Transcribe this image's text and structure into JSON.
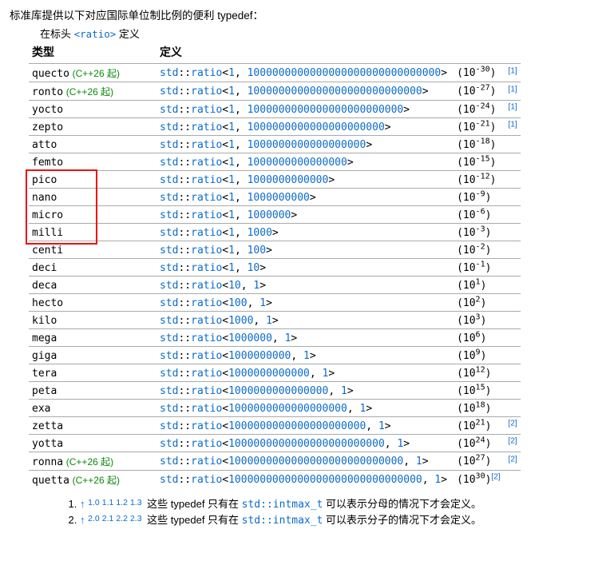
{
  "intro": "标准库提供以下对应国际单位制比例的便利 typedef：",
  "headerNote": {
    "prefix": "在标头 ",
    "code": "<ratio>",
    "suffix": " 定义"
  },
  "columns": {
    "type": "类型",
    "def": "定义"
  },
  "prefix": "std",
  "rationame": "ratio",
  "rows": [
    {
      "name": "quecto",
      "tag": "(C++26 起)",
      "num": "1",
      "den": "1000000000000000000000000000000",
      "exp": "-30",
      "ref": "[1]",
      "refLong": true
    },
    {
      "name": "ronto",
      "tag": "(C++26 起)",
      "num": "1",
      "den": "1000000000000000000000000000",
      "exp": "-27",
      "ref": "[1]",
      "refLong": true
    },
    {
      "name": "yocto",
      "tag": "",
      "num": "1",
      "den": "1000000000000000000000000",
      "exp": "-24",
      "ref": "[1]",
      "refLong": true
    },
    {
      "name": "zepto",
      "tag": "",
      "num": "1",
      "den": "1000000000000000000000",
      "exp": "-21",
      "ref": "[1]",
      "refLong": true
    },
    {
      "name": "atto",
      "tag": "",
      "num": "1",
      "den": "1000000000000000000",
      "exp": "-18",
      "ref": "",
      "refLong": false
    },
    {
      "name": "femto",
      "tag": "",
      "num": "1",
      "den": "1000000000000000",
      "exp": "-15",
      "ref": "",
      "refLong": false
    },
    {
      "name": "pico",
      "tag": "",
      "num": "1",
      "den": "1000000000000",
      "exp": "-12",
      "ref": "",
      "refLong": false
    },
    {
      "name": "nano",
      "tag": "",
      "num": "1",
      "den": "1000000000",
      "exp": "-9",
      "ref": "",
      "refLong": false
    },
    {
      "name": "micro",
      "tag": "",
      "num": "1",
      "den": "1000000",
      "exp": "-6",
      "ref": "",
      "refLong": false
    },
    {
      "name": "milli",
      "tag": "",
      "num": "1",
      "den": "1000",
      "exp": "-3",
      "ref": "",
      "refLong": false
    },
    {
      "name": "centi",
      "tag": "",
      "num": "1",
      "den": "100",
      "exp": "-2",
      "ref": "",
      "refLong": false
    },
    {
      "name": "deci",
      "tag": "",
      "num": "1",
      "den": "10",
      "exp": "-1",
      "ref": "",
      "refLong": false
    },
    {
      "name": "deca",
      "tag": "",
      "num": "10",
      "den": "1",
      "exp": "1",
      "ref": "",
      "refLong": false
    },
    {
      "name": "hecto",
      "tag": "",
      "num": "100",
      "den": "1",
      "exp": "2",
      "ref": "",
      "refLong": false
    },
    {
      "name": "kilo",
      "tag": "",
      "num": "1000",
      "den": "1",
      "exp": "3",
      "ref": "",
      "refLong": false
    },
    {
      "name": "mega",
      "tag": "",
      "num": "1000000",
      "den": "1",
      "exp": "6",
      "ref": "",
      "refLong": false
    },
    {
      "name": "giga",
      "tag": "",
      "num": "1000000000",
      "den": "1",
      "exp": "9",
      "ref": "",
      "refLong": false
    },
    {
      "name": "tera",
      "tag": "",
      "num": "1000000000000",
      "den": "1",
      "exp": "12",
      "ref": "",
      "refLong": false
    },
    {
      "name": "peta",
      "tag": "",
      "num": "1000000000000000",
      "den": "1",
      "exp": "15",
      "ref": "",
      "refLong": false
    },
    {
      "name": "exa",
      "tag": "",
      "num": "1000000000000000000",
      "den": "1",
      "exp": "18",
      "ref": "",
      "refLong": false
    },
    {
      "name": "zetta",
      "tag": "",
      "num": "1000000000000000000000",
      "den": "1",
      "exp": "21",
      "ref": "[2]",
      "refLong": true
    },
    {
      "name": "yotta",
      "tag": "",
      "num": "1000000000000000000000000",
      "den": "1",
      "exp": "24",
      "ref": "[2]",
      "refLong": true
    },
    {
      "name": "ronna",
      "tag": "(C++26 起)",
      "num": "1000000000000000000000000000",
      "den": "1",
      "exp": "27",
      "ref": "[2]",
      "refLong": true
    },
    {
      "name": "quetta",
      "tag": "(C++26 起)",
      "num": "1000000000000000000000000000000",
      "den": "1",
      "exp": "30",
      "ref": "[2]",
      "refLong": false
    }
  ],
  "highlight": {
    "from": "pico",
    "to": "milli"
  },
  "footnotes": [
    {
      "mark": "1.",
      "arrow": "↑",
      "refs": [
        "1.0",
        "1.1",
        "1.2",
        "1.3"
      ],
      "text1": "这些 typedef 只有在 ",
      "code": "std::intmax_t",
      "text2": " 可以表示分母的情况下才会定义。"
    },
    {
      "mark": "2.",
      "arrow": "↑",
      "refs": [
        "2.0",
        "2.1",
        "2.2",
        "2.3"
      ],
      "text1": "这些 typedef 只有在 ",
      "code": "std::intmax_t",
      "text2": " 可以表示分子的情况下才会定义。"
    }
  ]
}
